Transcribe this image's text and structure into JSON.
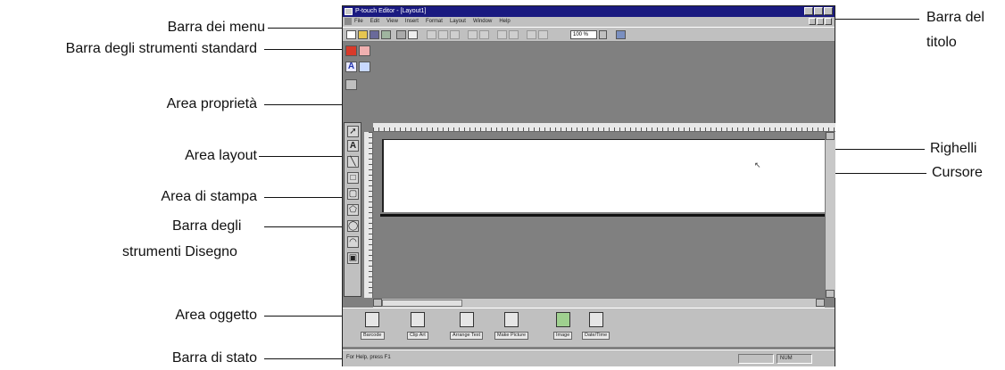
{
  "labels": {
    "menu_bar": "Barra dei menu",
    "standard_toolbar": "Barra degli strumenti standard",
    "properties_area": "Area proprietà",
    "layout_area": "Area layout",
    "print_area": "Area di stampa",
    "drawing_toolbar_1": "Barra degli",
    "drawing_toolbar_2": "strumenti Disegno",
    "object_area": "Area oggetto",
    "status_bar": "Barra di stato",
    "title_bar_1": "Barra del",
    "title_bar_2": "titolo",
    "rulers": "Righelli",
    "cursor": "Cursore"
  },
  "window": {
    "title": "P-touch Editor - [Layout1]",
    "menus": [
      "File",
      "Edit",
      "View",
      "Insert",
      "Format",
      "Layout",
      "Window",
      "Help"
    ],
    "zoom": "100 %",
    "objects": [
      "Barcode",
      "Clip Art",
      "Arrange Text",
      "Make Picture",
      "Image",
      "Date/Time"
    ],
    "status_text": "For Help, press F1",
    "status_num": "NUM"
  }
}
